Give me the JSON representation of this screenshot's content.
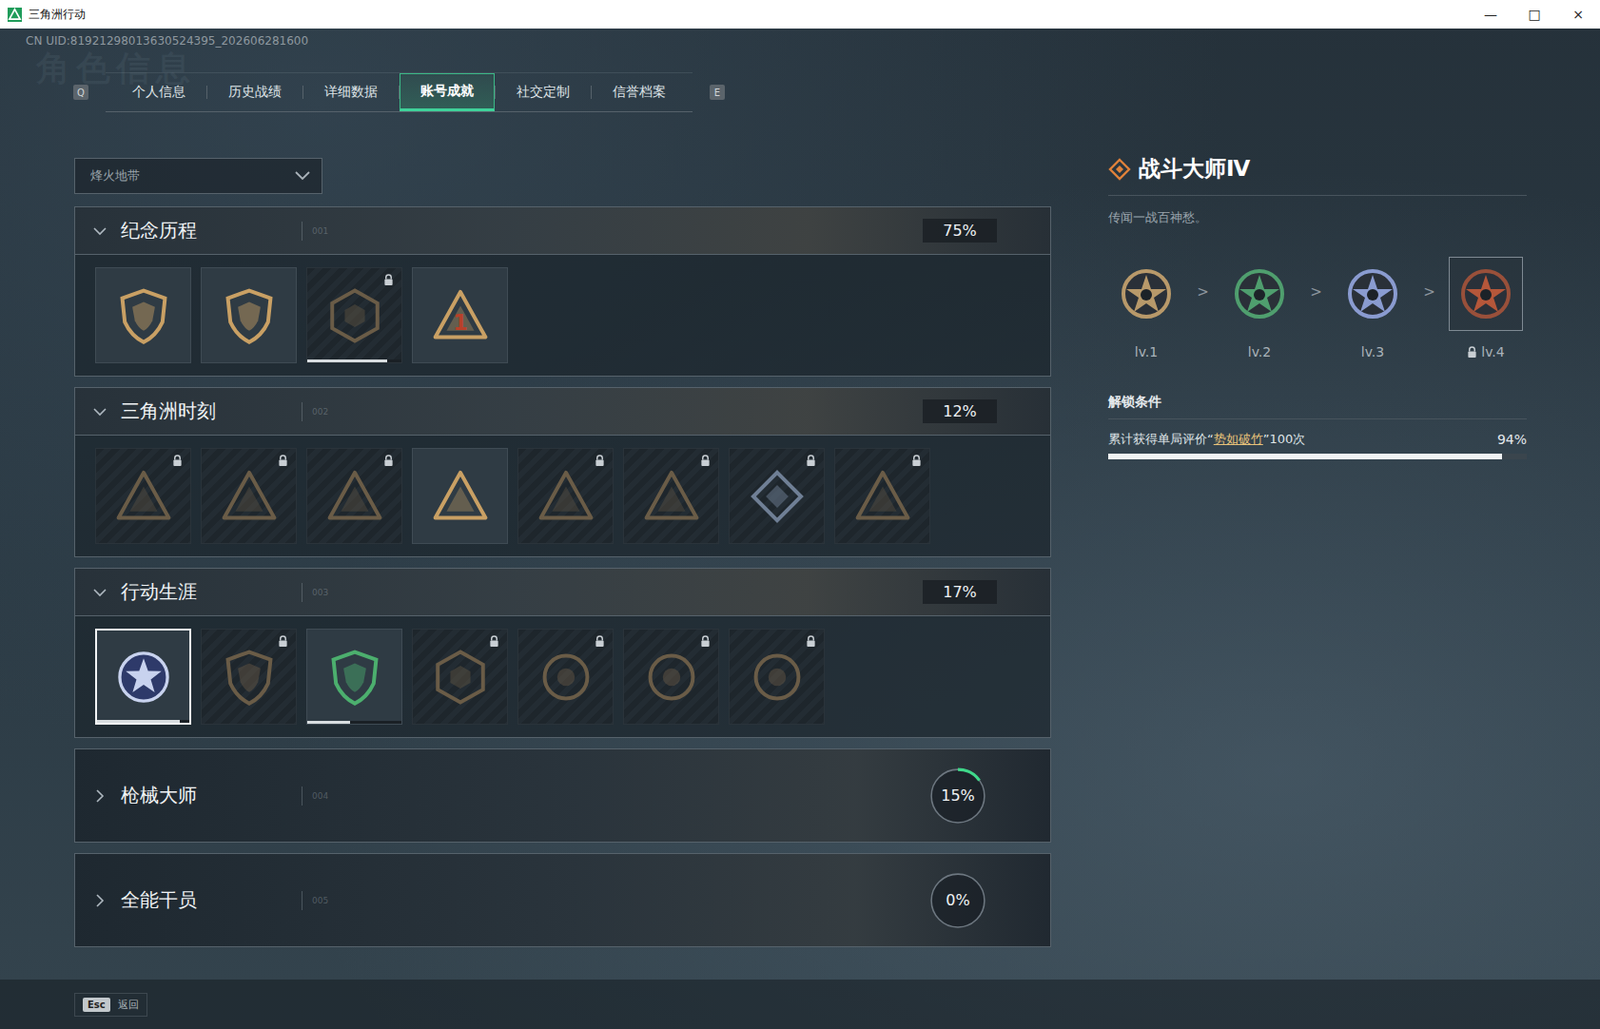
{
  "window": {
    "title": "三角洲行动",
    "controls": [
      "—",
      "□",
      "×"
    ]
  },
  "uid": "CN UID:81921298013630524395_202606281600",
  "watermark": "角色信息",
  "tabs": {
    "prev_key": "Q",
    "next_key": "E",
    "items": [
      {
        "label": "个人信息",
        "selected": false
      },
      {
        "label": "历史战绩",
        "selected": false
      },
      {
        "label": "详细数据",
        "selected": false
      },
      {
        "label": "账号成就",
        "selected": true
      },
      {
        "label": "社交定制",
        "selected": false
      },
      {
        "label": "信誉档案",
        "selected": false
      }
    ]
  },
  "mode_dropdown": {
    "value": "烽火地带",
    "expanded": false
  },
  "sections": [
    {
      "title": "纪念历程",
      "code": "001",
      "percent": "75%",
      "expanded": true,
      "badges": [
        {
          "locked": false,
          "selected": false
        },
        {
          "locked": false,
          "selected": false
        },
        {
          "locked": true,
          "selected": false,
          "level": 0.85
        },
        {
          "locked": false,
          "selected": false,
          "mark": "1"
        }
      ]
    },
    {
      "title": "三角洲时刻",
      "code": "002",
      "percent": "12%",
      "expanded": true,
      "badges": [
        {
          "locked": true,
          "selected": false
        },
        {
          "locked": true,
          "selected": false
        },
        {
          "locked": true,
          "selected": false
        },
        {
          "locked": false,
          "selected": false
        },
        {
          "locked": true,
          "selected": false
        },
        {
          "locked": true,
          "selected": false
        },
        {
          "locked": true,
          "selected": false
        },
        {
          "locked": true,
          "selected": false
        }
      ]
    },
    {
      "title": "行动生涯",
      "code": "003",
      "percent": "17%",
      "expanded": true,
      "badges": [
        {
          "locked": false,
          "selected": true,
          "level": 0.9
        },
        {
          "locked": true,
          "selected": false
        },
        {
          "locked": false,
          "selected": false,
          "level": 0.45
        },
        {
          "locked": true,
          "selected": false
        },
        {
          "locked": true,
          "selected": false
        },
        {
          "locked": true,
          "selected": false
        },
        {
          "locked": true,
          "selected": false
        }
      ]
    },
    {
      "title": "枪械大师",
      "code": "004",
      "percent": "15%",
      "expanded": false,
      "level": 0.15,
      "badges": []
    },
    {
      "title": "全能干员",
      "code": "005",
      "percent": "0%",
      "expanded": false,
      "level": 0,
      "badges": []
    }
  ],
  "detail": {
    "title": "战斗大师Ⅳ",
    "subtitle": "传闻一战百神愁。",
    "arrow": ">",
    "levels": [
      {
        "label": "lv.1",
        "locked": false,
        "selected": false,
        "color": "#b8996a"
      },
      {
        "label": "lv.2",
        "locked": false,
        "selected": false,
        "color": "#4f9e6e"
      },
      {
        "label": "lv.3",
        "locked": false,
        "selected": false,
        "color": "#8a9bd0"
      },
      {
        "label": "lv.4",
        "locked": true,
        "selected": true,
        "color": "#b5573a"
      }
    ],
    "unlock_heading": "解锁条件",
    "condition": {
      "prefix": "累计获得单局评价“",
      "highlight": "势如破竹",
      "suffix": "”100次",
      "reading": "94%",
      "level": 0.94
    }
  },
  "footer": {
    "key": "Esc",
    "label": "返回"
  }
}
